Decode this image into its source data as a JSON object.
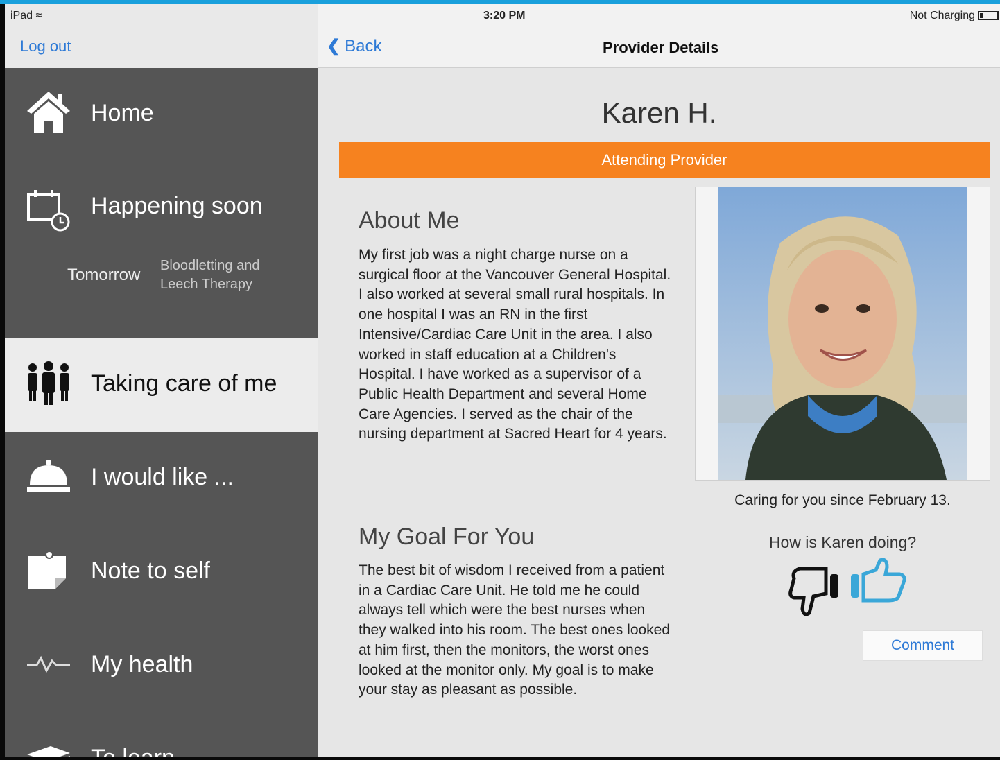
{
  "status_bar": {
    "carrier": "iPad",
    "time": "3:20 PM",
    "battery_status": "Not Charging"
  },
  "header": {
    "logout_label": "Log out",
    "back_label": "Back",
    "title": "Provider Details"
  },
  "sidebar": {
    "items": [
      {
        "label": "Home",
        "icon": "home-icon"
      },
      {
        "label": "Happening soon",
        "icon": "calendar-clock-icon"
      },
      {
        "label": "Taking care of me",
        "icon": "people-icon"
      },
      {
        "label": "I would like ...",
        "icon": "service-bell-icon"
      },
      {
        "label": "Note to self",
        "icon": "note-icon"
      },
      {
        "label": "My health",
        "icon": "heartbeat-icon"
      },
      {
        "label": "To learn",
        "icon": "book-icon"
      }
    ],
    "happening_soon": {
      "day": "Tomorrow",
      "event": "Bloodletting and Leech Therapy"
    },
    "active_item": "Taking care of me"
  },
  "provider": {
    "name": "Karen H.",
    "role": "Attending Provider",
    "about_heading": "About Me",
    "about_text": "My first job was a night charge nurse on a surgical floor at the Vancouver General Hospital. I also worked at several small rural hospitals. In one hospital I was an RN in the first Intensive/Cardiac Care Unit in the area. I also worked in staff education at a Children's Hospital. I have worked as a supervisor of a Public Health Department and several Home Care Agencies. I served as the chair of the nursing department at Sacred Heart for 4 years.",
    "goal_heading": "My Goal For You",
    "goal_text": "The best bit of wisdom I received from a patient in a Cardiac Care Unit. He told me he could always tell which were the best nurses when they walked into his room. The best ones looked at him first, then the monitors, the worst ones looked at the monitor only. My goal is to make your stay as pleasant as possible.",
    "caring_since": "Caring for you since February 13.",
    "rating_question": "How is Karen doing?",
    "comment_label": "Comment"
  },
  "colors": {
    "accent_orange": "#f6821f",
    "link_blue": "#2e7ad6",
    "sidebar_bg": "#555555",
    "thumbs_up": "#3aa7d8"
  }
}
